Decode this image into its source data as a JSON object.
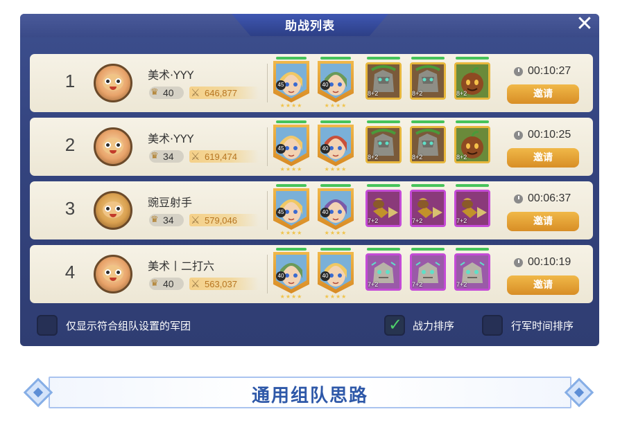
{
  "window": {
    "title": "助战列表",
    "close_icon": "close-icon"
  },
  "rows": [
    {
      "rank": "1",
      "name": "美术·YYY",
      "level": "40",
      "power": "646,877",
      "heroes": [
        {
          "level": "45",
          "color": "#f0c864"
        },
        {
          "level": "40",
          "color": "#6a9a5a"
        }
      ],
      "units": [
        {
          "tier": "8+2",
          "kind": "stone",
          "frame": "gold"
        },
        {
          "tier": "8+2",
          "kind": "stone",
          "frame": "gold"
        },
        {
          "tier": "8+2",
          "kind": "nut",
          "frame": "gold"
        }
      ],
      "time": "00:10:27",
      "invite": "邀请"
    },
    {
      "rank": "2",
      "name": "美术·YYY",
      "level": "34",
      "power": "619,474",
      "heroes": [
        {
          "level": "45",
          "color": "#f2c86a"
        },
        {
          "level": "40",
          "color": "#c8503a"
        }
      ],
      "units": [
        {
          "tier": "8+2",
          "kind": "stone",
          "frame": "gold"
        },
        {
          "tier": "8+2",
          "kind": "stone",
          "frame": "gold"
        },
        {
          "tier": "8+2",
          "kind": "nut",
          "frame": "gold"
        }
      ],
      "time": "00:10:25",
      "invite": "邀请"
    },
    {
      "rank": "3",
      "name": "豌豆射手",
      "level": "34",
      "power": "579,046",
      "heroes": [
        {
          "level": "45",
          "color": "#f0c864"
        },
        {
          "level": "40",
          "color": "#7a5aa8"
        }
      ],
      "units": [
        {
          "tier": "7+2",
          "kind": "drill",
          "frame": "purple"
        },
        {
          "tier": "7+2",
          "kind": "drill",
          "frame": "purple"
        },
        {
          "tier": "7+2",
          "kind": "drill",
          "frame": "purple"
        }
      ],
      "time": "00:06:37",
      "invite": "邀请"
    },
    {
      "rank": "4",
      "name": "美术丨二打六",
      "level": "40",
      "power": "563,037",
      "heroes": [
        {
          "level": "40",
          "color": "#6a9a5a"
        },
        {
          "level": "40",
          "color": "#f0c864"
        }
      ],
      "units": [
        {
          "tier": "7+2",
          "kind": "golem",
          "frame": "purple"
        },
        {
          "tier": "7+2",
          "kind": "golem",
          "frame": "purple"
        },
        {
          "tier": "7+2",
          "kind": "golem",
          "frame": "purple"
        }
      ],
      "time": "00:10:19",
      "invite": "邀请"
    }
  ],
  "footer": {
    "filter_label": "仅显示符合组队设置的军团",
    "filter_checked": false,
    "sort_power_label": "战力排序",
    "sort_power_checked": true,
    "sort_time_label": "行军时间排序",
    "sort_time_checked": false
  },
  "banner": {
    "title": "通用组队思路"
  },
  "colors": {
    "invite": "#e0a030",
    "check": "#4ed06a",
    "power_text": "#b77520",
    "banner_text": "#2e58a8",
    "panel": "#34447f"
  }
}
